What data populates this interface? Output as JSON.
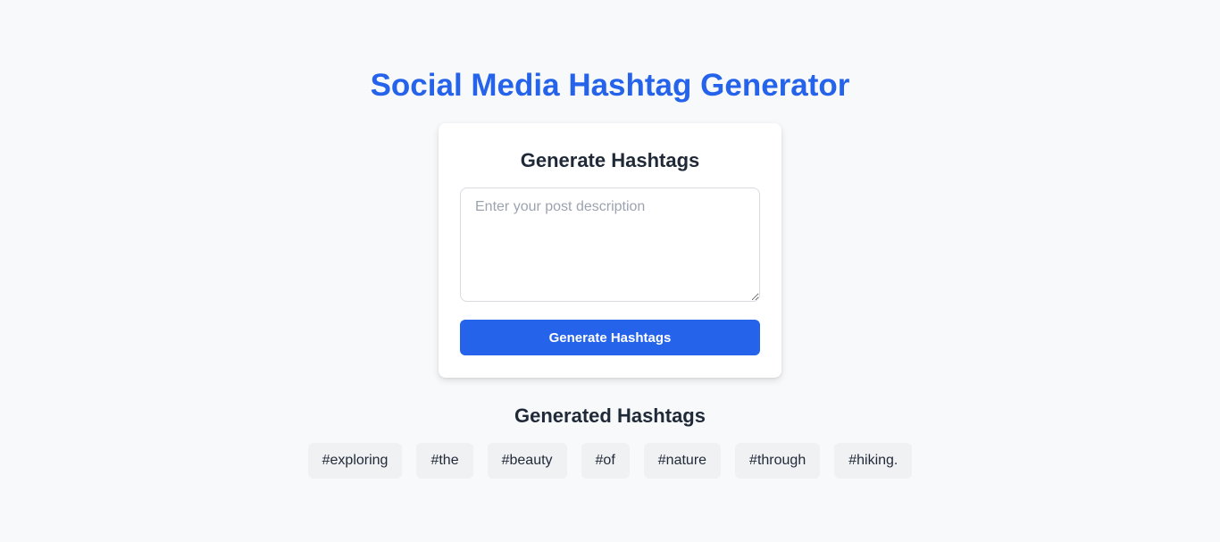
{
  "header": {
    "title": "Social Media Hashtag Generator"
  },
  "form": {
    "title": "Generate Hashtags",
    "description_placeholder": "Enter your post description",
    "description_value": "",
    "submit_label": "Generate Hashtags"
  },
  "results": {
    "title": "Generated Hashtags",
    "hashtags": [
      "#exploring",
      "#the",
      "#beauty",
      "#of",
      "#nature",
      "#through",
      "#hiking."
    ]
  },
  "colors": {
    "accent": "#2563eb",
    "text": "#1f2937",
    "background": "#f8f9fb",
    "tag_background": "#f0f1f3"
  }
}
